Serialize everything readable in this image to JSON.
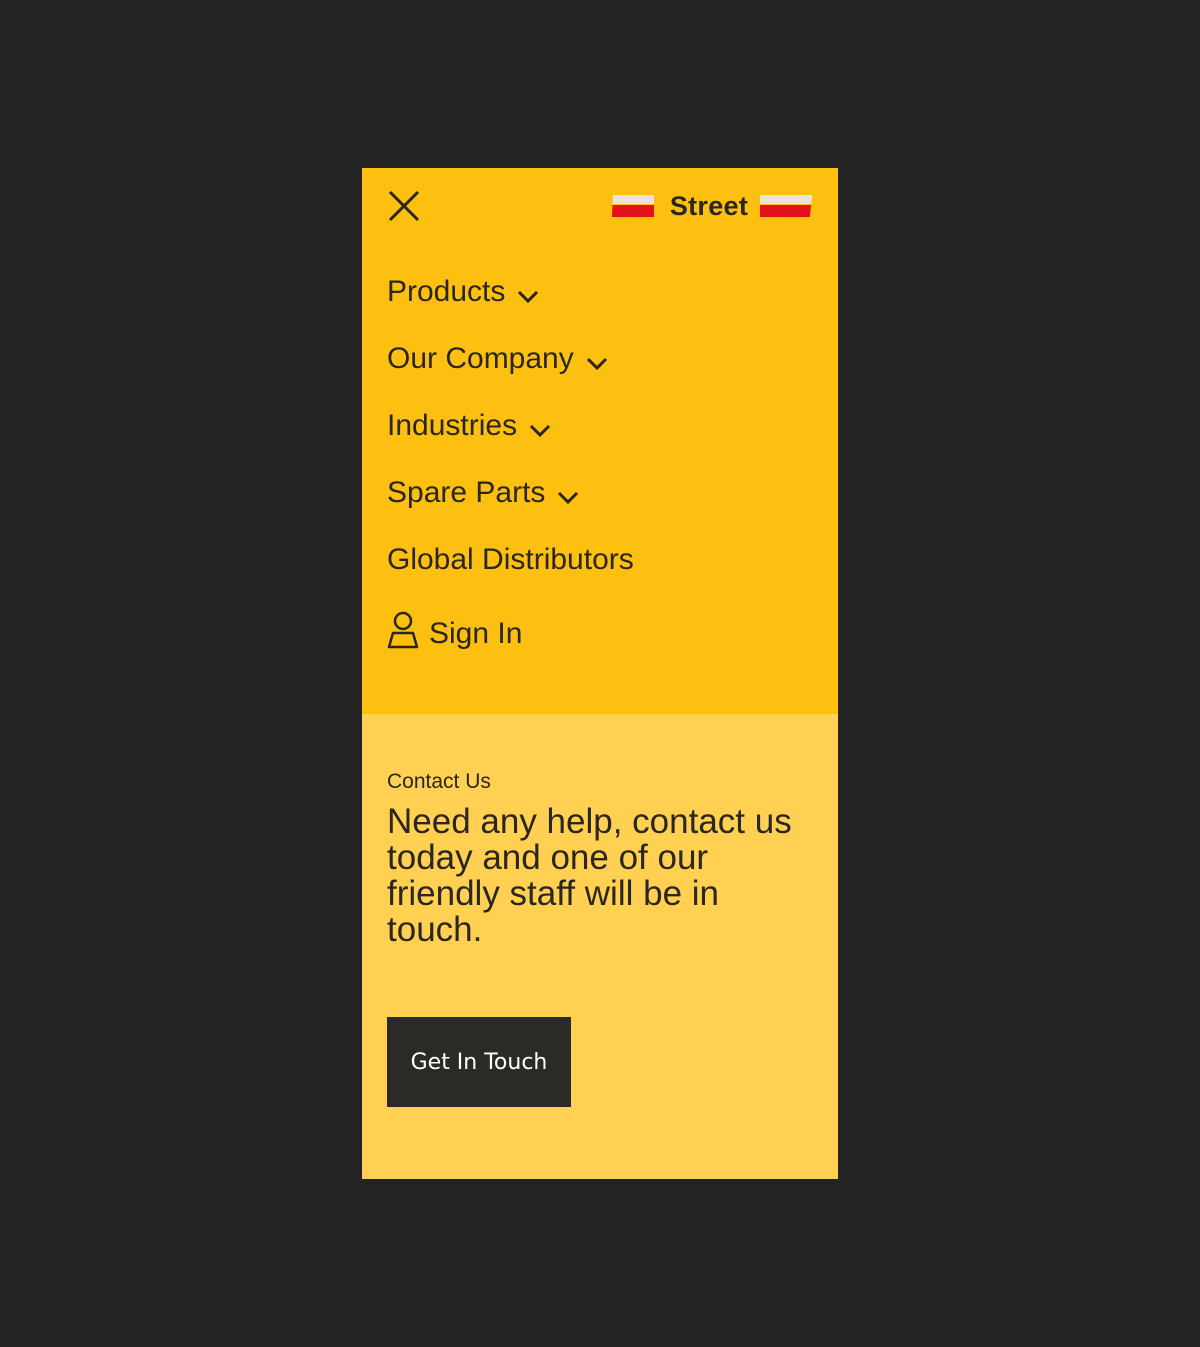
{
  "header": {
    "close_icon": "close-icon",
    "logo_text": "Street"
  },
  "nav": {
    "items": [
      {
        "label": "Products",
        "has_submenu": true,
        "icon": "chevron-down-icon"
      },
      {
        "label": "Our Company",
        "has_submenu": true,
        "icon": "chevron-down-icon"
      },
      {
        "label": "Industries",
        "has_submenu": true,
        "icon": "chevron-down-icon"
      },
      {
        "label": "Spare Parts",
        "has_submenu": true,
        "icon": "chevron-down-icon"
      },
      {
        "label": "Global Distributors",
        "has_submenu": false
      }
    ],
    "sign_in": {
      "label": "Sign In",
      "icon": "user-icon"
    }
  },
  "contact": {
    "kicker": "Contact Us",
    "text": "Need any help, contact us today and one of our friendly staff will be in touch.",
    "button_label": "Get In Touch"
  },
  "colors": {
    "backdrop": "#232323",
    "menu_bg": "#fdbf10",
    "contact_bg": "#ffd051",
    "text": "#2a2620",
    "button_bg": "#2c2a26",
    "logo_red": "#e3101b"
  }
}
